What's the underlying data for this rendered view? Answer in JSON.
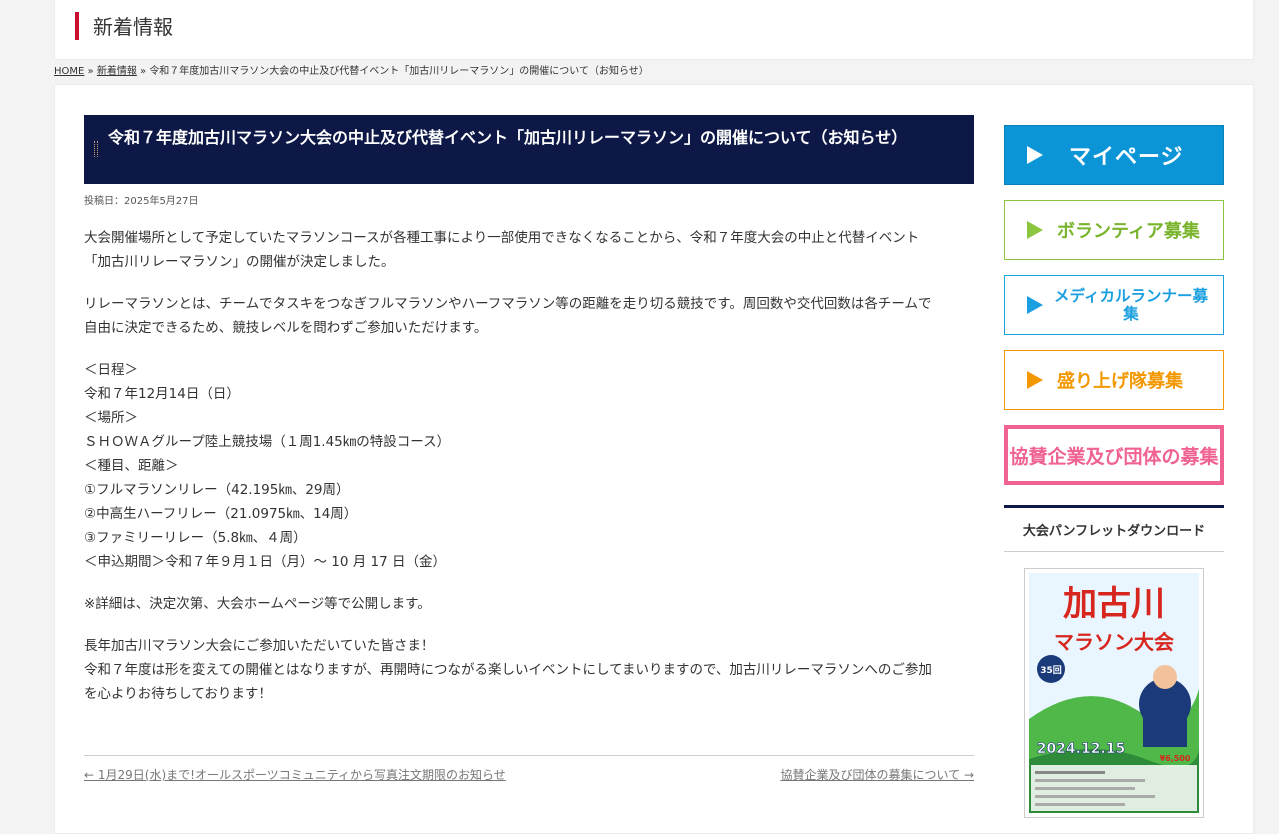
{
  "header": {
    "title": "新着情報"
  },
  "breadcrumb": {
    "home": "HOME",
    "sep1": " » ",
    "news": "新着情報",
    "sep2": " » ",
    "current": "令和７年度加古川マラソン大会の中止及び代替イベント「加古川リレーマラソン」の開催について（お知らせ）"
  },
  "article": {
    "title": "令和７年度加古川マラソン大会の中止及び代替イベント「加古川リレーマラソン」の開催について（お知らせ）",
    "date": "投稿日：2025年5月27日",
    "para1": [
      "大会開催場所として予定していたマラソンコースが各種工事により一部使用できなくなることから、令和７年度大会の中止と代替イベント",
      "「加古川リレーマラソン」の開催が決定しました。"
    ],
    "para2": [
      "リレーマラソンとは、チームでタスキをつなぎフルマラソンやハーフマラソン等の距離を走り切る競技です。周回数や交代回数は各チームで",
      "自由に決定できるため、競技レベルを問わずご参加いただけます。"
    ],
    "para3": [
      "＜日程＞",
      "令和７年12月14日（日）",
      "＜場所＞",
      "ＳＨＯＷＡグループ陸上競技場（１周1.45㎞の特設コース）",
      "＜種目、距離＞",
      "①フルマラソンリレー（42.195㎞、29周）",
      "②中高生ハーフリレー（21.0975㎞、14周）",
      "③ファミリーリレー（5.8㎞、４周）",
      "＜申込期間＞令和７年９月１日（月）～ 10 月 17 日（金）"
    ],
    "para4": [
      "※詳細は、決定次第、大会ホームページ等で公開します。"
    ],
    "para5": [
      "長年加古川マラソン大会にご参加いただいていた皆さま！",
      "令和７年度は形を変えての開催とはなりますが、再開時につながる楽しいイベントにしてまいりますので、加古川リレーマラソンへのご参加",
      "を心よりお待ちしております！"
    ]
  },
  "post_nav": {
    "prev": "← 1月29日(水)まで!オールスポーツコミュニティから写真注文期限のお知らせ",
    "next": "協賛企業及び団体の募集について →"
  },
  "sidebar": {
    "mypage": "マイページ",
    "volunteer": "ボランティア募集",
    "medical": "メディカルランナー募集",
    "cheer": "盛り上げ隊募集",
    "sponsor": "協賛企業及び団体の募集",
    "pamphlet_heading": "大会パンフレットダウンロード",
    "pamphlet": {
      "title_line1": "加古川",
      "title_line2": "マラソン大会",
      "anniv": "35回",
      "date": "2024.12.15",
      "fee": "¥6,500"
    }
  },
  "colors": {
    "title_bg": "#0d1846",
    "accent_red": "#c8102e",
    "mypage": "#0b94d6",
    "volunteer": "#8cc63f",
    "medical": "#1a9fe0",
    "cheer": "#f39800",
    "sponsor": "#f06292"
  }
}
